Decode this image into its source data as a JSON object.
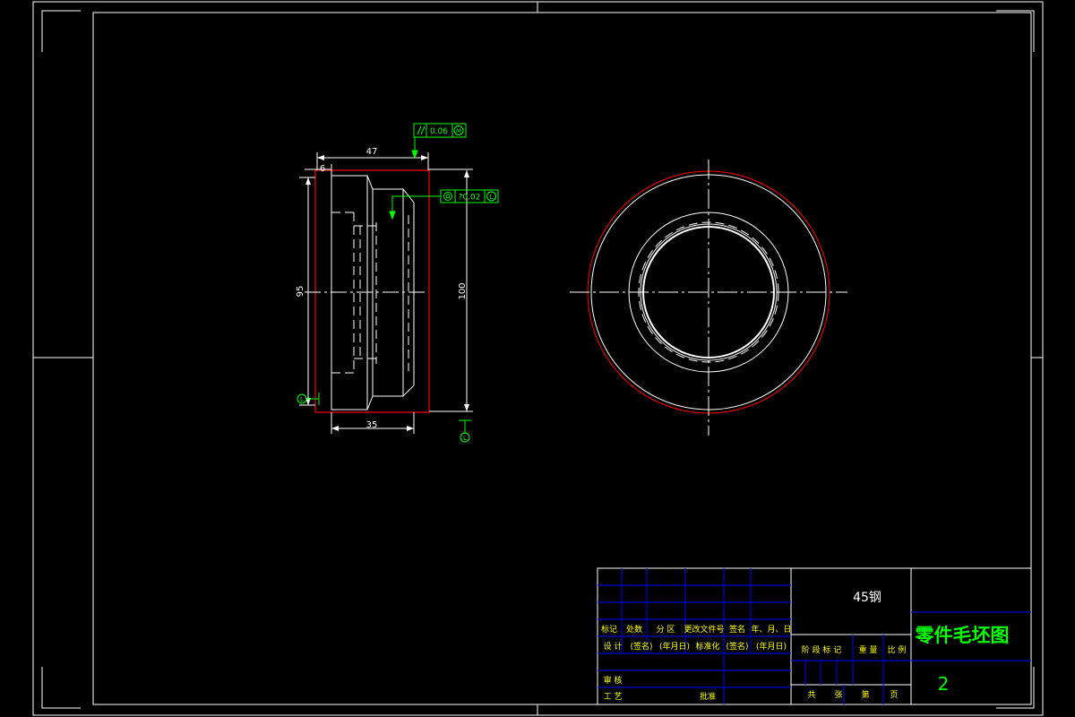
{
  "colors": {
    "background": "#000000",
    "frame": "#ffffff",
    "contour_red": "#ff0000",
    "annotation_green": "#00ff00",
    "table_blue": "#0000ff"
  },
  "left_view": {
    "dims": {
      "overall_length": "47",
      "flange": "6",
      "length_35": "35",
      "diameter_95": "95",
      "diameter_100": "100"
    },
    "tolerances": {
      "parallelism_value": "0.06",
      "coaxiality_value": "?0.02"
    }
  },
  "title_block": {
    "material": "45钢",
    "drawing_name": "零件毛坯图",
    "sheet_number": "2",
    "header_row": [
      "标记",
      "处数",
      "分 区",
      "更改文件号",
      "签名",
      "年、月、日"
    ],
    "design_row": [
      "设 计",
      "(签名)",
      "(年月日)",
      "标准化",
      "(签名)",
      "(年月日)"
    ],
    "review_label": "审 核",
    "process_label": "工 艺",
    "approve_label": "批准",
    "stage_labels": [
      "阶 段 标 记",
      "重 量",
      "比 例"
    ],
    "sheets_row": [
      "共",
      "张",
      "第",
      "页"
    ]
  }
}
